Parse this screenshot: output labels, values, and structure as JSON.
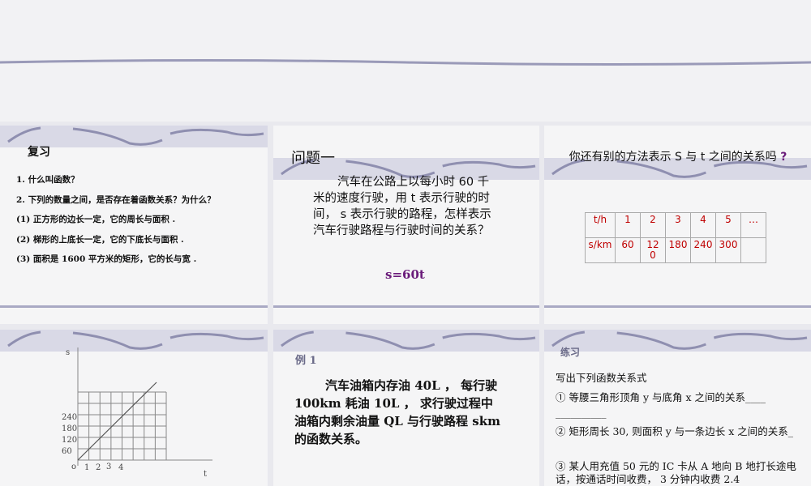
{
  "slides": {
    "review": {
      "title": "复习",
      "lines": [
        "1. 什么叫函数？",
        "2. 下列的数量之间，是否存在着函数关系？为什么？",
        "(1) 正方形的边长一定，它的周长与面积 .",
        "(2) 梯形的上底长一定，它的下底长与面积 .",
        "(3) 面积是 1600 平方米的矩形，它的长与宽 ."
      ]
    },
    "problem1": {
      "title": "问题一",
      "body": "汽车在公路上以每小时 60 千米的速度行驶，用 t 表示行驶的时间， s 表示行驶的路程，怎样表示汽车行驶路程与行驶时间的关系？",
      "answer": "s=60t"
    },
    "table_slide": {
      "title": "你还有别的方法表示 S 与 t 之间的关系吗",
      "qmark": "?",
      "header": [
        "t/h",
        "1",
        "2",
        "3",
        "4",
        "5",
        "…"
      ],
      "row": [
        "s/km",
        "60",
        "120",
        "180",
        "240",
        "300",
        ""
      ]
    },
    "graph": {
      "y_label": "s",
      "x_label": "t",
      "origin": "o",
      "y_ticks": [
        "60",
        "120",
        "180",
        "240"
      ],
      "x_ticks": [
        "1",
        "2",
        "3",
        "4"
      ]
    },
    "example1": {
      "title": "例 1",
      "body": "汽车油箱内存油 40L ， 每行驶 100km 耗油 10L ， 求行驶过程中油箱内剩余油量 QL 与行驶路程 skm 的函数关系。"
    },
    "practice": {
      "title": "练习",
      "intro": "写出下列函数关系式",
      "items": [
        "① 等腰三角形顶角 y 与底角 x 之间的关系____ __________",
        "② 矩形周长 30, 则面积 y 与一条边长 x 之间的关系_",
        "③  某人用充值 50 元的 IC 卡从 A 地向 B 地打长途电话，按通话时间收费， 3 分钟内收费 2.4"
      ]
    }
  },
  "colors": {
    "accent": "#6a1b7a",
    "band": "#d9d9e6"
  }
}
